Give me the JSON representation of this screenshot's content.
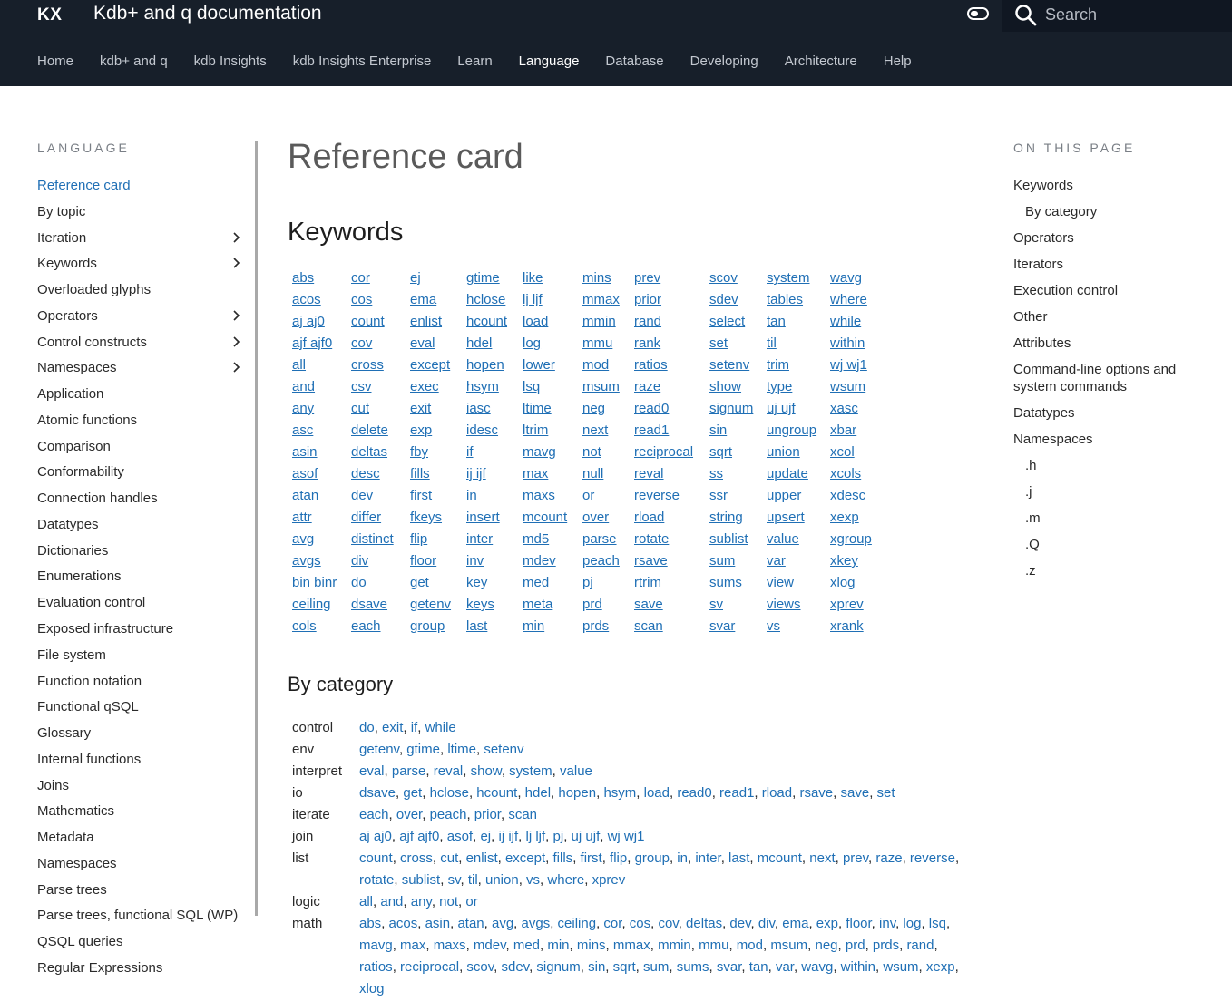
{
  "header": {
    "logo": "KX",
    "site_title": "Kdb+ and q documentation",
    "search_placeholder": "Search"
  },
  "nav": {
    "tabs": [
      {
        "label": "Home"
      },
      {
        "label": "kdb+ and q"
      },
      {
        "label": "kdb Insights"
      },
      {
        "label": "kdb Insights Enterprise"
      },
      {
        "label": "Learn"
      },
      {
        "label": "Language",
        "active": true
      },
      {
        "label": "Database"
      },
      {
        "label": "Developing"
      },
      {
        "label": "Architecture"
      },
      {
        "label": "Help"
      }
    ]
  },
  "sidebar": {
    "heading": "LANGUAGE",
    "items": [
      {
        "label": "Reference card",
        "active": true
      },
      {
        "label": "By topic"
      },
      {
        "label": "Iteration",
        "expandable": true
      },
      {
        "label": "Keywords",
        "expandable": true
      },
      {
        "label": "Overloaded glyphs"
      },
      {
        "label": "Operators",
        "expandable": true
      },
      {
        "label": "Control constructs",
        "expandable": true
      },
      {
        "label": "Namespaces",
        "expandable": true
      },
      {
        "label": "Application"
      },
      {
        "label": "Atomic functions"
      },
      {
        "label": "Comparison"
      },
      {
        "label": "Conformability"
      },
      {
        "label": "Connection handles"
      },
      {
        "label": "Datatypes"
      },
      {
        "label": "Dictionaries"
      },
      {
        "label": "Enumerations"
      },
      {
        "label": "Evaluation control"
      },
      {
        "label": "Exposed infrastructure"
      },
      {
        "label": "File system"
      },
      {
        "label": "Function notation"
      },
      {
        "label": "Functional qSQL"
      },
      {
        "label": "Glossary"
      },
      {
        "label": "Internal functions"
      },
      {
        "label": "Joins"
      },
      {
        "label": "Mathematics"
      },
      {
        "label": "Metadata"
      },
      {
        "label": "Namespaces"
      },
      {
        "label": "Parse trees"
      },
      {
        "label": "Parse trees, functional SQL (WP)"
      },
      {
        "label": "QSQL queries"
      },
      {
        "label": "Regular Expressions"
      }
    ]
  },
  "main": {
    "title": "Reference card",
    "keywords_heading": "Keywords",
    "keyword_columns": [
      [
        "abs",
        "acos",
        "aj aj0",
        "ajf ajf0",
        "all",
        "and",
        "any",
        "asc",
        "asin",
        "asof",
        "atan",
        "attr",
        "avg",
        "avgs",
        "bin binr",
        "ceiling",
        "cols"
      ],
      [
        "cor",
        "cos",
        "count",
        "cov",
        "cross",
        "csv",
        "cut",
        "delete",
        "deltas",
        "desc",
        "dev",
        "differ",
        "distinct",
        "div",
        "do",
        "dsave",
        "each"
      ],
      [
        "ej",
        "ema",
        "enlist",
        "eval",
        "except",
        "exec",
        "exit",
        "exp",
        "fby",
        "fills",
        "first",
        "fkeys",
        "flip",
        "floor",
        "get",
        "getenv",
        "group"
      ],
      [
        "gtime",
        "hclose",
        "hcount",
        "hdel",
        "hopen",
        "hsym",
        "iasc",
        "idesc",
        "if",
        "ij ijf",
        "in",
        "insert",
        "inter",
        "inv",
        "key",
        "keys",
        "last"
      ],
      [
        "like",
        "lj ljf",
        "load",
        "log",
        "lower",
        "lsq",
        "ltime",
        "ltrim",
        "mavg",
        "max",
        "maxs",
        "mcount",
        "md5",
        "mdev",
        "med",
        "meta",
        "min"
      ],
      [
        "mins",
        "mmax",
        "mmin",
        "mmu",
        "mod",
        "msum",
        "neg",
        "next",
        "not",
        "null",
        "or",
        "over",
        "parse",
        "peach",
        "pj",
        "prd",
        "prds"
      ],
      [
        "prev",
        "prior",
        "rand",
        "rank",
        "ratios",
        "raze",
        "read0",
        "read1",
        "reciprocal",
        "reval",
        "reverse",
        "rload",
        "rotate",
        "rsave",
        "rtrim",
        "save",
        "scan"
      ],
      [
        "scov",
        "sdev",
        "select",
        "set",
        "setenv",
        "show",
        "signum",
        "sin",
        "sqrt",
        "ss",
        "ssr",
        "string",
        "sublist",
        "sum",
        "sums",
        "sv",
        "svar"
      ],
      [
        "system",
        "tables",
        "tan",
        "til",
        "trim",
        "type",
        "uj ujf",
        "ungroup",
        "union",
        "update",
        "upper",
        "upsert",
        "value",
        "var",
        "view",
        "views",
        "vs"
      ],
      [
        "wavg",
        "where",
        "while",
        "within",
        "wj wj1",
        "wsum",
        "xasc",
        "xbar",
        "xcol",
        "xcols",
        "xdesc",
        "xexp",
        "xgroup",
        "xkey",
        "xlog",
        "xprev",
        "xrank"
      ]
    ],
    "category_heading": "By category",
    "categories": [
      {
        "name": "control",
        "links": [
          "do",
          "exit",
          "if",
          "while"
        ]
      },
      {
        "name": "env",
        "links": [
          "getenv",
          "gtime",
          "ltime",
          "setenv"
        ]
      },
      {
        "name": "interpret",
        "links": [
          "eval",
          "parse",
          "reval",
          "show",
          "system",
          "value"
        ]
      },
      {
        "name": "io",
        "links": [
          "dsave",
          "get",
          "hclose",
          "hcount",
          "hdel",
          "hopen",
          "hsym",
          "load",
          "read0",
          "read1",
          "rload",
          "rsave",
          "save",
          "set"
        ]
      },
      {
        "name": "iterate",
        "links": [
          "each",
          "over",
          "peach",
          "prior",
          "scan"
        ]
      },
      {
        "name": "join",
        "links": [
          "aj aj0",
          "ajf ajf0",
          "asof",
          "ej",
          "ij ijf",
          "lj ljf",
          "pj",
          "uj ujf",
          "wj wj1"
        ]
      },
      {
        "name": "list",
        "links": [
          "count",
          "cross",
          "cut",
          "enlist",
          "except",
          "fills",
          "first",
          "flip",
          "group",
          "in",
          "inter",
          "last",
          "mcount",
          "next",
          "prev",
          "raze",
          "reverse",
          "rotate",
          "sublist",
          "sv",
          "til",
          "union",
          "vs",
          "where",
          "xprev"
        ]
      },
      {
        "name": "logic",
        "links": [
          "all",
          "and",
          "any",
          "not",
          "or"
        ]
      },
      {
        "name": "math",
        "links": [
          "abs",
          "acos",
          "asin",
          "atan",
          "avg",
          "avgs",
          "ceiling",
          "cor",
          "cos",
          "cov",
          "deltas",
          "dev",
          "div",
          "ema",
          "exp",
          "floor",
          "inv",
          "log",
          "lsq",
          "mavg",
          "max",
          "maxs",
          "mdev",
          "med",
          "min",
          "mins",
          "mmax",
          "mmin",
          "mmu",
          "mod",
          "msum",
          "neg",
          "prd",
          "prds",
          "rand",
          "ratios",
          "reciprocal",
          "scov",
          "sdev",
          "signum",
          "sin",
          "sqrt",
          "sum",
          "sums",
          "svar",
          "tan",
          "var",
          "wavg",
          "within",
          "wsum",
          "xexp",
          "xlog"
        ]
      }
    ]
  },
  "toc": {
    "heading": "ON THIS PAGE",
    "items": [
      {
        "label": "Keywords",
        "level": 1
      },
      {
        "label": "By category",
        "level": 2
      },
      {
        "label": "Operators",
        "level": 1
      },
      {
        "label": "Iterators",
        "level": 1
      },
      {
        "label": "Execution control",
        "level": 1
      },
      {
        "label": "Other",
        "level": 1
      },
      {
        "label": "Attributes",
        "level": 1
      },
      {
        "label": "Command-line options and system commands",
        "level": 1
      },
      {
        "label": "Datatypes",
        "level": 1
      },
      {
        "label": "Namespaces",
        "level": 1
      },
      {
        "label": ".h",
        "level": 3
      },
      {
        "label": ".j",
        "level": 3
      },
      {
        "label": ".m",
        "level": 3
      },
      {
        "label": ".Q",
        "level": 3
      },
      {
        "label": ".z",
        "level": 3
      }
    ]
  },
  "colors": {
    "header_bg": "#171f2a",
    "link": "#1f6fb5",
    "active_sidebar": "#1f6fb5"
  }
}
